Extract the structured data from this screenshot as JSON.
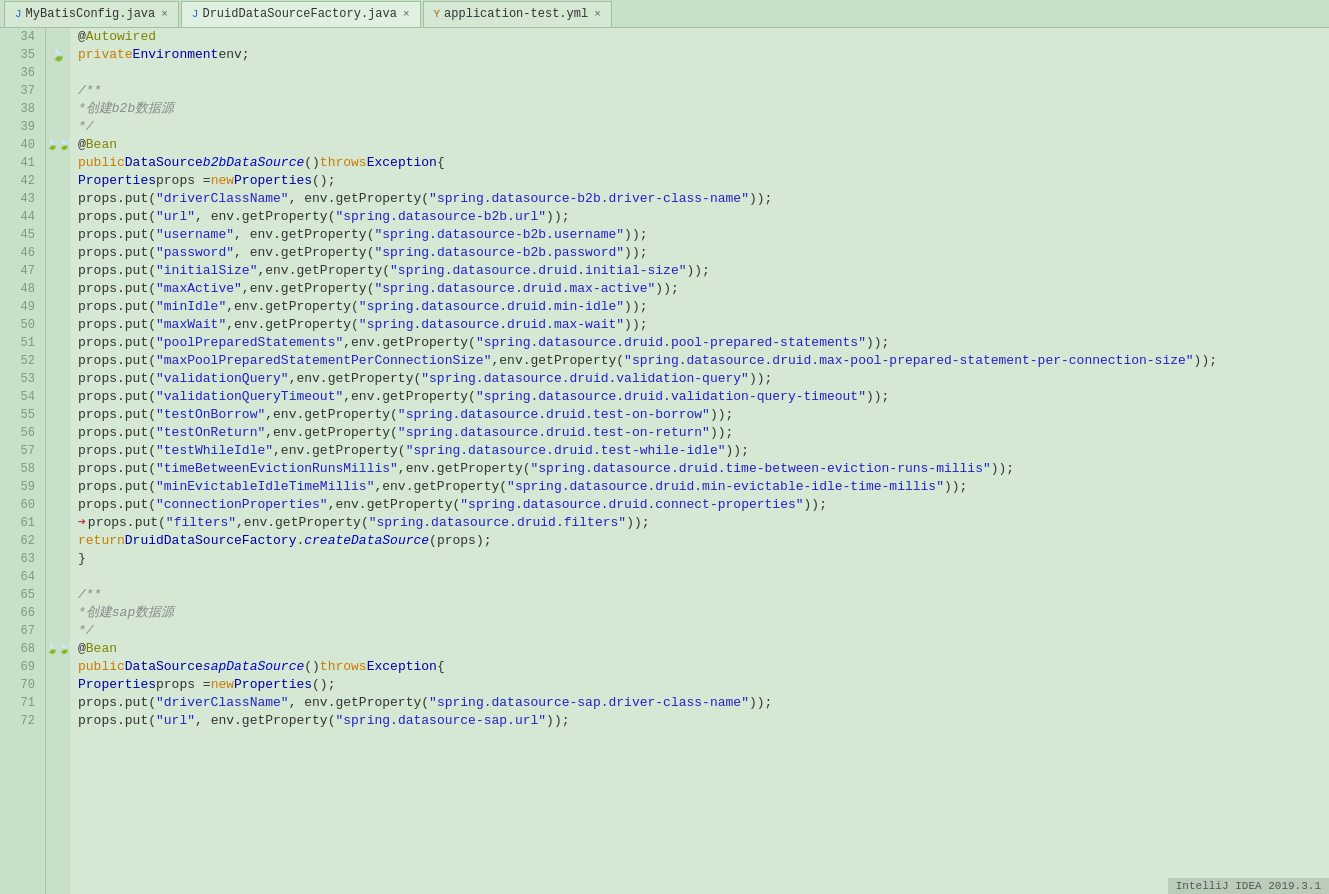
{
  "tabs": [
    {
      "label": "MyBatisConfig.java",
      "icon": "J",
      "active": false,
      "closable": true
    },
    {
      "label": "DruidDataSourceFactory.java",
      "icon": "J",
      "active": true,
      "closable": true
    },
    {
      "label": "application-test.yml",
      "icon": "Y",
      "active": false,
      "closable": true
    }
  ],
  "lines": [
    {
      "num": 34,
      "gutter": "",
      "arrow": false,
      "code": [
        {
          "t": "plain",
          "v": "    @"
        },
        {
          "t": "kw2",
          "v": "Autowired"
        }
      ]
    },
    {
      "num": 35,
      "gutter": "leaf",
      "arrow": false,
      "code": [
        {
          "t": "kw",
          "v": "    private"
        },
        {
          "t": "plain",
          "v": " "
        },
        {
          "t": "type",
          "v": "Environment"
        },
        {
          "t": "plain",
          "v": " env;"
        }
      ]
    },
    {
      "num": 36,
      "gutter": "",
      "arrow": false,
      "code": []
    },
    {
      "num": 37,
      "gutter": "",
      "arrow": false,
      "code": [
        {
          "t": "comment",
          "v": "    /**"
        }
      ]
    },
    {
      "num": 38,
      "gutter": "",
      "arrow": false,
      "code": [
        {
          "t": "comment",
          "v": "     * "
        },
        {
          "t": "chinese",
          "v": "创建b2b数据源"
        }
      ]
    },
    {
      "num": 39,
      "gutter": "",
      "arrow": false,
      "code": [
        {
          "t": "comment",
          "v": "     */"
        }
      ]
    },
    {
      "num": 40,
      "gutter": "double-leaf",
      "arrow": false,
      "code": [
        {
          "t": "plain",
          "v": "    @"
        },
        {
          "t": "kw2",
          "v": "Bean"
        }
      ]
    },
    {
      "num": 41,
      "gutter": "",
      "arrow": false,
      "code": [
        {
          "t": "kw",
          "v": "    public"
        },
        {
          "t": "plain",
          "v": " "
        },
        {
          "t": "type",
          "v": "DataSource"
        },
        {
          "t": "plain",
          "v": " "
        },
        {
          "t": "method",
          "v": "b2bDataSource"
        },
        {
          "t": "plain",
          "v": "() "
        },
        {
          "t": "kw",
          "v": "throws"
        },
        {
          "t": "plain",
          "v": " "
        },
        {
          "t": "type",
          "v": "Exception"
        },
        {
          "t": "plain",
          "v": " {"
        }
      ]
    },
    {
      "num": 42,
      "gutter": "",
      "arrow": false,
      "code": [
        {
          "t": "plain",
          "v": "        "
        },
        {
          "t": "type",
          "v": "Properties"
        },
        {
          "t": "plain",
          "v": " props = "
        },
        {
          "t": "kw",
          "v": "new"
        },
        {
          "t": "plain",
          "v": " "
        },
        {
          "t": "type",
          "v": "Properties"
        },
        {
          "t": "plain",
          "v": "();"
        }
      ]
    },
    {
      "num": 43,
      "gutter": "",
      "arrow": false,
      "code": [
        {
          "t": "plain",
          "v": "        props.put("
        },
        {
          "t": "str",
          "v": "\"driverClassName\""
        },
        {
          "t": "plain",
          "v": ", env.getProperty("
        },
        {
          "t": "str",
          "v": "\"spring.datasource-b2b.driver-class-name\""
        },
        {
          "t": "plain",
          "v": "));"
        }
      ]
    },
    {
      "num": 44,
      "gutter": "",
      "arrow": false,
      "code": [
        {
          "t": "plain",
          "v": "        props.put("
        },
        {
          "t": "str",
          "v": "\"url\""
        },
        {
          "t": "plain",
          "v": ", env.getProperty("
        },
        {
          "t": "str",
          "v": "\"spring.datasource-b2b.url\""
        },
        {
          "t": "plain",
          "v": "));"
        }
      ]
    },
    {
      "num": 45,
      "gutter": "",
      "arrow": false,
      "code": [
        {
          "t": "plain",
          "v": "        props.put("
        },
        {
          "t": "str",
          "v": "\"username\""
        },
        {
          "t": "plain",
          "v": ", env.getProperty("
        },
        {
          "t": "str",
          "v": "\"spring.datasource-b2b.username\""
        },
        {
          "t": "plain",
          "v": "));"
        }
      ]
    },
    {
      "num": 46,
      "gutter": "",
      "arrow": false,
      "code": [
        {
          "t": "plain",
          "v": "        props.put("
        },
        {
          "t": "str",
          "v": "\"password\""
        },
        {
          "t": "plain",
          "v": ", env.getProperty("
        },
        {
          "t": "str",
          "v": "\"spring.datasource-b2b.password\""
        },
        {
          "t": "plain",
          "v": "));"
        }
      ]
    },
    {
      "num": 47,
      "gutter": "",
      "arrow": false,
      "code": [
        {
          "t": "plain",
          "v": "        props.put("
        },
        {
          "t": "str",
          "v": "\"initialSize\""
        },
        {
          "t": "plain",
          "v": ",env.getProperty("
        },
        {
          "t": "str",
          "v": "\"spring.datasource.druid.initial-size\""
        },
        {
          "t": "plain",
          "v": "));"
        }
      ]
    },
    {
      "num": 48,
      "gutter": "",
      "arrow": false,
      "code": [
        {
          "t": "plain",
          "v": "        props.put("
        },
        {
          "t": "str",
          "v": "\"maxActive\""
        },
        {
          "t": "plain",
          "v": ",env.getProperty("
        },
        {
          "t": "str",
          "v": "\"spring.datasource.druid.max-active\""
        },
        {
          "t": "plain",
          "v": "));"
        }
      ]
    },
    {
      "num": 49,
      "gutter": "",
      "arrow": false,
      "code": [
        {
          "t": "plain",
          "v": "        props.put("
        },
        {
          "t": "str",
          "v": "\"minIdle\""
        },
        {
          "t": "plain",
          "v": ",env.getProperty("
        },
        {
          "t": "str",
          "v": "\"spring.datasource.druid.min-idle\""
        },
        {
          "t": "plain",
          "v": "));"
        }
      ]
    },
    {
      "num": 50,
      "gutter": "",
      "arrow": false,
      "code": [
        {
          "t": "plain",
          "v": "        props.put("
        },
        {
          "t": "str",
          "v": "\"maxWait\""
        },
        {
          "t": "plain",
          "v": ",env.getProperty("
        },
        {
          "t": "str",
          "v": "\"spring.datasource.druid.max-wait\""
        },
        {
          "t": "plain",
          "v": "));"
        }
      ]
    },
    {
      "num": 51,
      "gutter": "",
      "arrow": false,
      "code": [
        {
          "t": "plain",
          "v": "        props.put("
        },
        {
          "t": "str",
          "v": "\"poolPreparedStatements\""
        },
        {
          "t": "plain",
          "v": ",env.getProperty("
        },
        {
          "t": "str",
          "v": "\"spring.datasource.druid.pool-prepared-statements\""
        },
        {
          "t": "plain",
          "v": "));"
        }
      ]
    },
    {
      "num": 52,
      "gutter": "",
      "arrow": false,
      "code": [
        {
          "t": "plain",
          "v": "        props.put("
        },
        {
          "t": "str",
          "v": "\"maxPoolPreparedStatementPerConnectionSize\""
        },
        {
          "t": "plain",
          "v": ",env.getProperty("
        },
        {
          "t": "str",
          "v": "\"spring.datasource.druid.max-pool-prepared-statement-per-connection-size\""
        },
        {
          "t": "plain",
          "v": "));"
        }
      ]
    },
    {
      "num": 53,
      "gutter": "",
      "arrow": false,
      "code": [
        {
          "t": "plain",
          "v": "        props.put("
        },
        {
          "t": "str",
          "v": "\"validationQuery\""
        },
        {
          "t": "plain",
          "v": ",env.getProperty("
        },
        {
          "t": "str",
          "v": "\"spring.datasource.druid.validation-query\""
        },
        {
          "t": "plain",
          "v": "));"
        }
      ]
    },
    {
      "num": 54,
      "gutter": "",
      "arrow": false,
      "code": [
        {
          "t": "plain",
          "v": "        props.put("
        },
        {
          "t": "str",
          "v": "\"validationQueryTimeout\""
        },
        {
          "t": "plain",
          "v": ",env.getProperty("
        },
        {
          "t": "str",
          "v": "\"spring.datasource.druid.validation-query-timeout\""
        },
        {
          "t": "plain",
          "v": "));"
        }
      ]
    },
    {
      "num": 55,
      "gutter": "",
      "arrow": false,
      "code": [
        {
          "t": "plain",
          "v": "        props.put("
        },
        {
          "t": "str",
          "v": "\"testOnBorrow\""
        },
        {
          "t": "plain",
          "v": ",env.getProperty("
        },
        {
          "t": "str",
          "v": "\"spring.datasource.druid.test-on-borrow\""
        },
        {
          "t": "plain",
          "v": "));"
        }
      ]
    },
    {
      "num": 56,
      "gutter": "",
      "arrow": false,
      "code": [
        {
          "t": "plain",
          "v": "        props.put("
        },
        {
          "t": "str",
          "v": "\"testOnReturn\""
        },
        {
          "t": "plain",
          "v": ",env.getProperty("
        },
        {
          "t": "str",
          "v": "\"spring.datasource.druid.test-on-return\""
        },
        {
          "t": "plain",
          "v": "));"
        }
      ]
    },
    {
      "num": 57,
      "gutter": "",
      "arrow": false,
      "code": [
        {
          "t": "plain",
          "v": "        props.put("
        },
        {
          "t": "str",
          "v": "\"testWhileIdle\""
        },
        {
          "t": "plain",
          "v": ",env.getProperty("
        },
        {
          "t": "str",
          "v": "\"spring.datasource.druid.test-while-idle\""
        },
        {
          "t": "plain",
          "v": "));"
        }
      ]
    },
    {
      "num": 58,
      "gutter": "",
      "arrow": false,
      "code": [
        {
          "t": "plain",
          "v": "        props.put("
        },
        {
          "t": "str",
          "v": "\"timeBetweenEvictionRunsMillis\""
        },
        {
          "t": "plain",
          "v": ",env.getProperty("
        },
        {
          "t": "str",
          "v": "\"spring.datasource.druid.time-between-eviction-runs-millis\""
        },
        {
          "t": "plain",
          "v": "));"
        }
      ]
    },
    {
      "num": 59,
      "gutter": "",
      "arrow": false,
      "code": [
        {
          "t": "plain",
          "v": "        props.put("
        },
        {
          "t": "str",
          "v": "\"minEvictableIdleTimeMillis\""
        },
        {
          "t": "plain",
          "v": ",env.getProperty("
        },
        {
          "t": "str",
          "v": "\"spring.datasource.druid.min-evictable-idle-time-millis\""
        },
        {
          "t": "plain",
          "v": "));"
        }
      ]
    },
    {
      "num": 60,
      "gutter": "",
      "arrow": false,
      "code": [
        {
          "t": "plain",
          "v": "        props.put("
        },
        {
          "t": "str",
          "v": "\"connectionProperties\""
        },
        {
          "t": "plain",
          "v": ",env.getProperty("
        },
        {
          "t": "str",
          "v": "\"spring.datasource.druid.connect-properties\""
        },
        {
          "t": "plain",
          "v": "));"
        }
      ]
    },
    {
      "num": 61,
      "gutter": "",
      "arrow": true,
      "code": [
        {
          "t": "plain",
          "v": "        props.put("
        },
        {
          "t": "str",
          "v": "\"filters\""
        },
        {
          "t": "plain",
          "v": ",env.getProperty("
        },
        {
          "t": "str",
          "v": "\"spring.datasource.druid.filters\""
        },
        {
          "t": "plain",
          "v": "));"
        }
      ]
    },
    {
      "num": 62,
      "gutter": "",
      "arrow": false,
      "code": [
        {
          "t": "plain",
          "v": "        "
        },
        {
          "t": "kw",
          "v": "return"
        },
        {
          "t": "plain",
          "v": " "
        },
        {
          "t": "type",
          "v": "DruidDataSourceFactory"
        },
        {
          "t": "plain",
          "v": "."
        },
        {
          "t": "method",
          "v": "createDataSource"
        },
        {
          "t": "plain",
          "v": "(props);"
        }
      ]
    },
    {
      "num": 63,
      "gutter": "",
      "arrow": false,
      "code": [
        {
          "t": "plain",
          "v": "    }"
        }
      ]
    },
    {
      "num": 64,
      "gutter": "",
      "arrow": false,
      "code": []
    },
    {
      "num": 65,
      "gutter": "",
      "arrow": false,
      "code": [
        {
          "t": "comment",
          "v": "    /**"
        }
      ]
    },
    {
      "num": 66,
      "gutter": "",
      "arrow": false,
      "code": [
        {
          "t": "comment",
          "v": "     * "
        },
        {
          "t": "chinese",
          "v": "创建sap数据源"
        }
      ]
    },
    {
      "num": 67,
      "gutter": "",
      "arrow": false,
      "code": [
        {
          "t": "comment",
          "v": "     */"
        }
      ]
    },
    {
      "num": 68,
      "gutter": "double-leaf",
      "arrow": false,
      "code": [
        {
          "t": "plain",
          "v": "    @"
        },
        {
          "t": "kw2",
          "v": "Bean"
        }
      ]
    },
    {
      "num": 69,
      "gutter": "",
      "arrow": false,
      "code": [
        {
          "t": "kw",
          "v": "    public"
        },
        {
          "t": "plain",
          "v": " "
        },
        {
          "t": "type",
          "v": "DataSource"
        },
        {
          "t": "plain",
          "v": " "
        },
        {
          "t": "method",
          "v": "sapDataSource"
        },
        {
          "t": "plain",
          "v": "() "
        },
        {
          "t": "kw",
          "v": "throws"
        },
        {
          "t": "plain",
          "v": " "
        },
        {
          "t": "type",
          "v": "Exception"
        },
        {
          "t": "plain",
          "v": " {"
        }
      ]
    },
    {
      "num": 70,
      "gutter": "",
      "arrow": false,
      "code": [
        {
          "t": "plain",
          "v": "        "
        },
        {
          "t": "type",
          "v": "Properties"
        },
        {
          "t": "plain",
          "v": " props = "
        },
        {
          "t": "kw",
          "v": "new"
        },
        {
          "t": "plain",
          "v": " "
        },
        {
          "t": "type",
          "v": "Properties"
        },
        {
          "t": "plain",
          "v": "();"
        }
      ]
    },
    {
      "num": 71,
      "gutter": "",
      "arrow": false,
      "code": [
        {
          "t": "plain",
          "v": "        props.put("
        },
        {
          "t": "str",
          "v": "\"driverClassName\""
        },
        {
          "t": "plain",
          "v": ", env.getProperty("
        },
        {
          "t": "str",
          "v": "\"spring.datasource-sap.driver-class-name\""
        },
        {
          "t": "plain",
          "v": "));"
        }
      ]
    },
    {
      "num": 72,
      "gutter": "",
      "arrow": false,
      "code": [
        {
          "t": "plain",
          "v": "        props.put("
        },
        {
          "t": "str",
          "v": "\"url\""
        },
        {
          "t": "plain",
          "v": ", env.getProperty("
        },
        {
          "t": "str",
          "v": "\"spring.datasource-sap.url\""
        },
        {
          "t": "plain",
          "v": "));"
        }
      ]
    }
  ],
  "status_bar": {
    "text": "IntelliJ IDEA 2019.3.1"
  },
  "colors": {
    "bg": "#d4e8d4",
    "gutter_bg": "#c8dfc8",
    "tab_active_bg": "#e0f0e0",
    "string_color": "#2222cc",
    "keyword_color": "#cc7700",
    "annotation_color": "#808000"
  }
}
